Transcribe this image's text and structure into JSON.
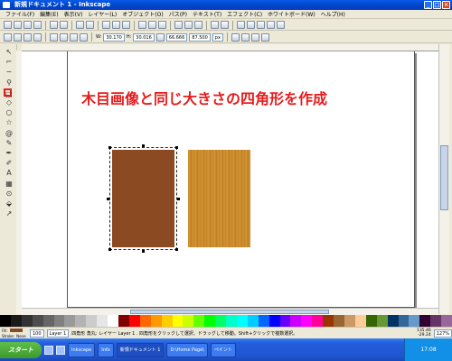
{
  "window": {
    "title": "新規ドキュメント 1 - Inkscape",
    "controls": [
      "_",
      "□",
      "×"
    ]
  },
  "menu": [
    "ファイル(F)",
    "編集(E)",
    "表示(V)",
    "レイヤー(L)",
    "オブジェクト(O)",
    "パス(P)",
    "テキスト(T)",
    "エフェクト(C)",
    "ホワイトボード(W)",
    "ヘルプ(H)"
  ],
  "tool_controls": {
    "w": "W:",
    "w_value": "30.170",
    "h": "H:",
    "h_value": "30.016",
    "width_value": "66.666",
    "zoom": "87.500",
    "unit": "px"
  },
  "tools": [
    "select-icon",
    "node-icon",
    "tweak-icon",
    "zoom-icon",
    "rectangle-icon",
    "box3d-icon",
    "ellipse-icon",
    "star-icon",
    "spiral-icon",
    "pencil-icon",
    "pen-icon",
    "calligraphy-icon",
    "text-icon",
    "gradient-icon",
    "dropper-icon",
    "paint-bucket-icon",
    "connector-icon"
  ],
  "tool_glyphs": [
    "↖",
    "⌐",
    "~",
    "⚲",
    "□",
    "◇",
    "○",
    "☆",
    "@",
    "✎",
    "✒",
    "✐",
    "A",
    "▦",
    "⊙",
    "⬙",
    "↗"
  ],
  "active_tool_index": 4,
  "canvas": {
    "heading": "木目画像と同じ大きさの四角形を作成",
    "heading_color": "#e61c1c",
    "rect_color": "#8b4a22",
    "wood_color": "#c88a2a"
  },
  "palette": [
    "#000000",
    "#1a1a1a",
    "#333333",
    "#4d4d4d",
    "#666666",
    "#808080",
    "#999999",
    "#b3b3b3",
    "#cccccc",
    "#e6e6e6",
    "#ffffff",
    "#800000",
    "#ff0000",
    "#ff6600",
    "#ff9900",
    "#ffcc00",
    "#ffff00",
    "#ccff00",
    "#66ff00",
    "#00ff00",
    "#00ff66",
    "#00ffcc",
    "#00ffff",
    "#00ccff",
    "#0066ff",
    "#0000ff",
    "#6600ff",
    "#cc00ff",
    "#ff00ff",
    "#ff0099",
    "#993300",
    "#996633",
    "#cc9966",
    "#ffcc99",
    "#336600",
    "#669933",
    "#003366",
    "#336699",
    "#6699cc",
    "#330033",
    "#663366",
    "#996699"
  ],
  "status": {
    "fill_label": "Fill:",
    "stroke_label": "Stroke:",
    "fill_color": "#8b4a22",
    "stroke_value": "None",
    "opacity_value": "100",
    "layer": "Layer 1",
    "message": "四角形 角丸: レイヤー Layer 1 . 四角形をクリックして選択、ドラッグして移動。Shift+クリックで複数選択。",
    "x_coord": "135.46",
    "y_coord": "-29.24",
    "zoom_pct": "127%"
  },
  "taskbar": {
    "start": "スタート",
    "items": [
      "Inkscape",
      "Info",
      "新規ドキュメント 1",
      "D:\\Home Page\\",
      "ペイント"
    ],
    "active_index": 2,
    "clock": "17:08"
  }
}
